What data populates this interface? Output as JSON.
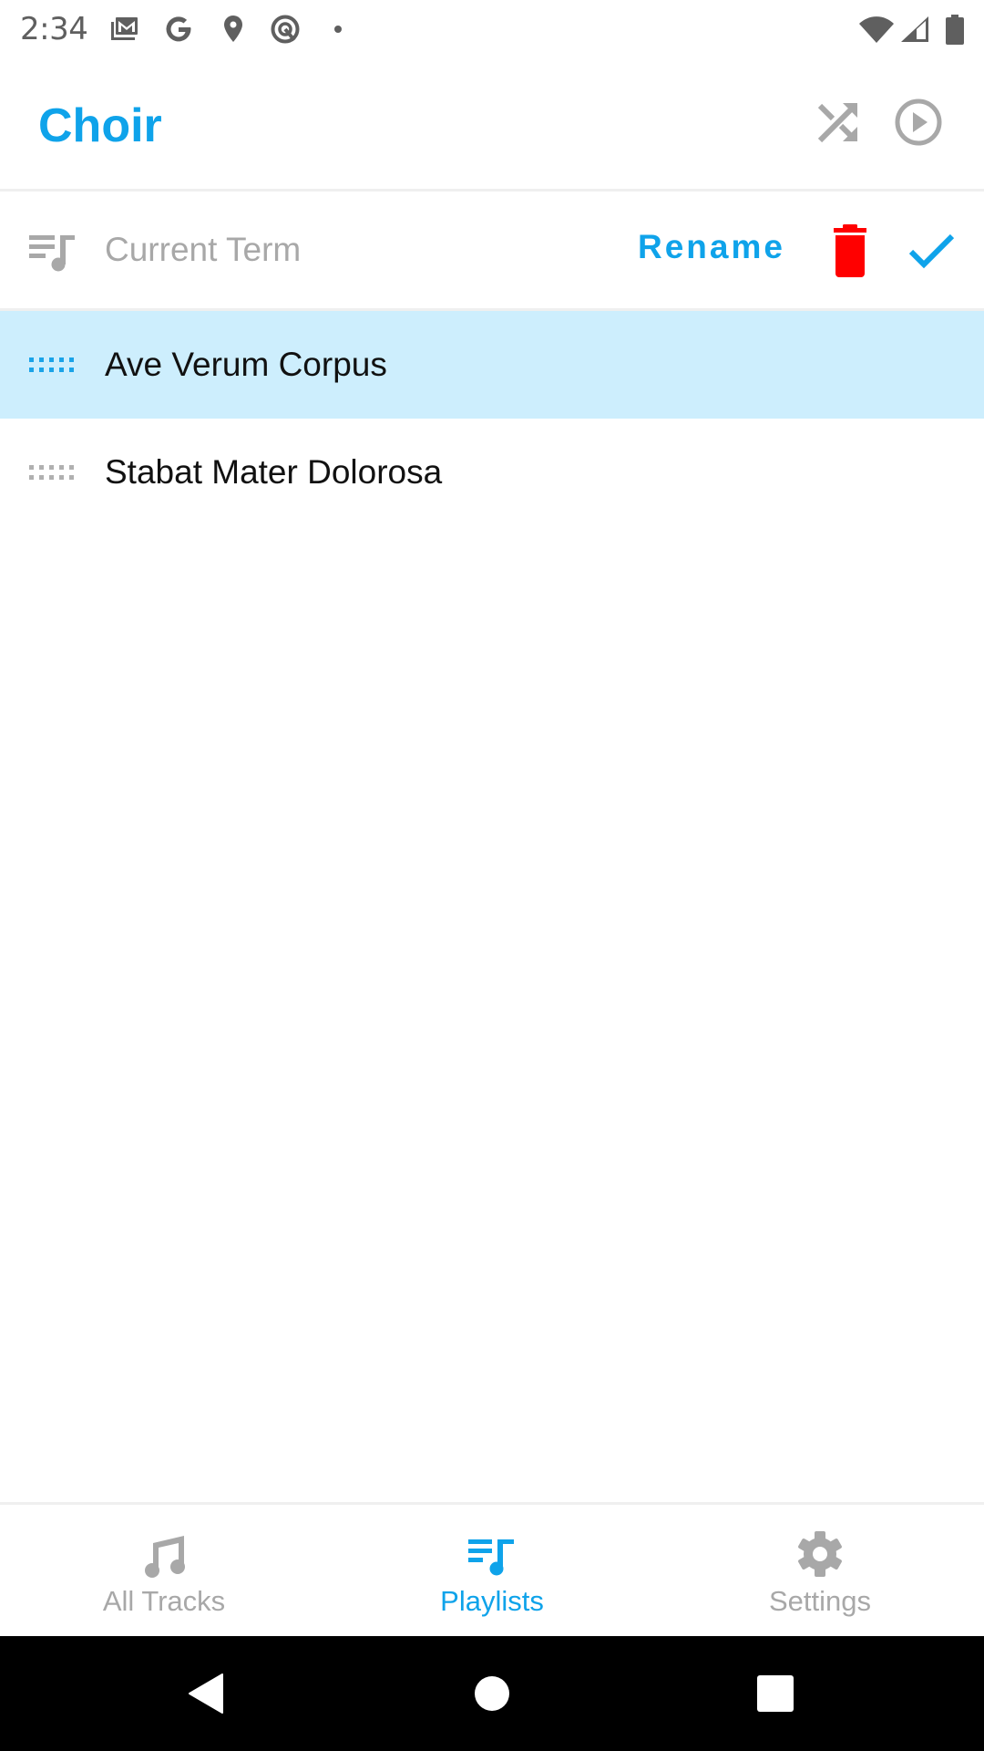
{
  "status_bar": {
    "time": "2:34",
    "notification_icons": [
      "gmail-icon",
      "google-icon",
      "location-icon",
      "at-sign-icon",
      "dot-icon"
    ],
    "system_icons": [
      "wifi-icon",
      "cellular-signal-icon",
      "battery-icon"
    ]
  },
  "app_bar": {
    "title": "Choir",
    "actions": [
      {
        "name": "shuffle",
        "icon": "shuffle-icon"
      },
      {
        "name": "play",
        "icon": "play-circle-icon"
      }
    ]
  },
  "playlist_editor": {
    "icon": "playlist-icon",
    "name_value": "",
    "name_placeholder": "Current Term",
    "rename_label": "Rename",
    "delete_icon": "trash-icon",
    "confirm_icon": "check-icon"
  },
  "tracks": [
    {
      "title": "Ave Verum Corpus",
      "selected": true
    },
    {
      "title": "Stabat Mater Dolorosa",
      "selected": false
    }
  ],
  "bottom_nav": {
    "items": [
      {
        "label": "All Tracks",
        "icon": "music-note-icon",
        "active": false
      },
      {
        "label": "Playlists",
        "icon": "playlist-icon",
        "active": true
      },
      {
        "label": "Settings",
        "icon": "gear-icon",
        "active": false
      }
    ]
  },
  "system_nav": [
    "back",
    "home",
    "recents"
  ],
  "colors": {
    "accent": "#0fa3ea",
    "selected_row": "#cdeefd",
    "delete": "#ff0000",
    "inactive": "#a8a8a8"
  }
}
